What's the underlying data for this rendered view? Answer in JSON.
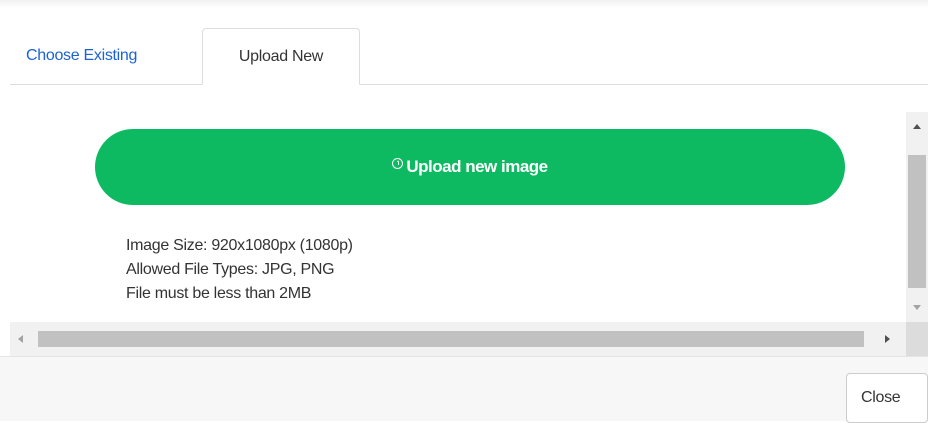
{
  "tabs": [
    {
      "label": "Choose Existing",
      "active": false
    },
    {
      "label": "Upload New",
      "active": true
    }
  ],
  "upload": {
    "button_label": "Upload new image",
    "icon": "upload-circle-icon",
    "info_lines": [
      "Image Size: 920x1080px (1080p)",
      "Allowed File Types: JPG, PNG",
      "File must be less than 2MB"
    ]
  },
  "footer": {
    "close_label": "Close"
  },
  "colors": {
    "accent_button": "#0dba62",
    "link": "#1a62d6"
  }
}
